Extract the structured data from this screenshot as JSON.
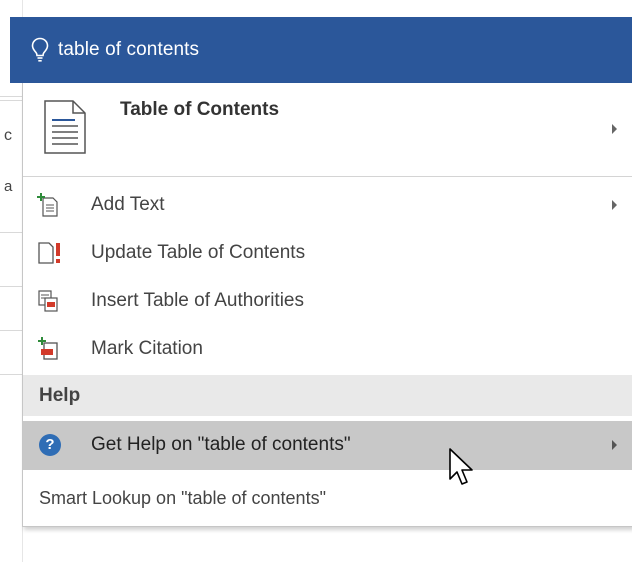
{
  "search": {
    "query": "table of contents"
  },
  "background": {
    "frag_c": "c",
    "frag_a": "a"
  },
  "top_result": {
    "label": "Table of Contents"
  },
  "items": [
    {
      "label": "Add Text",
      "icon": "add-text-icon",
      "has_submenu": true
    },
    {
      "label": "Update Table of Contents",
      "icon": "update-toc-icon",
      "has_submenu": false
    },
    {
      "label": "Insert Table of Authorities",
      "icon": "insert-toa-icon",
      "has_submenu": false
    },
    {
      "label": "Mark Citation",
      "icon": "mark-citation-icon",
      "has_submenu": false
    }
  ],
  "help": {
    "header": "Help",
    "get_help_label": "Get Help on \"table of contents\""
  },
  "smart_lookup": {
    "label": "Smart Lookup on \"table of contents\""
  },
  "colors": {
    "accent": "#2b579a",
    "hover": "#c8c8c8",
    "section_bg": "#e9e9e9",
    "help_icon": "#2f6db5"
  }
}
